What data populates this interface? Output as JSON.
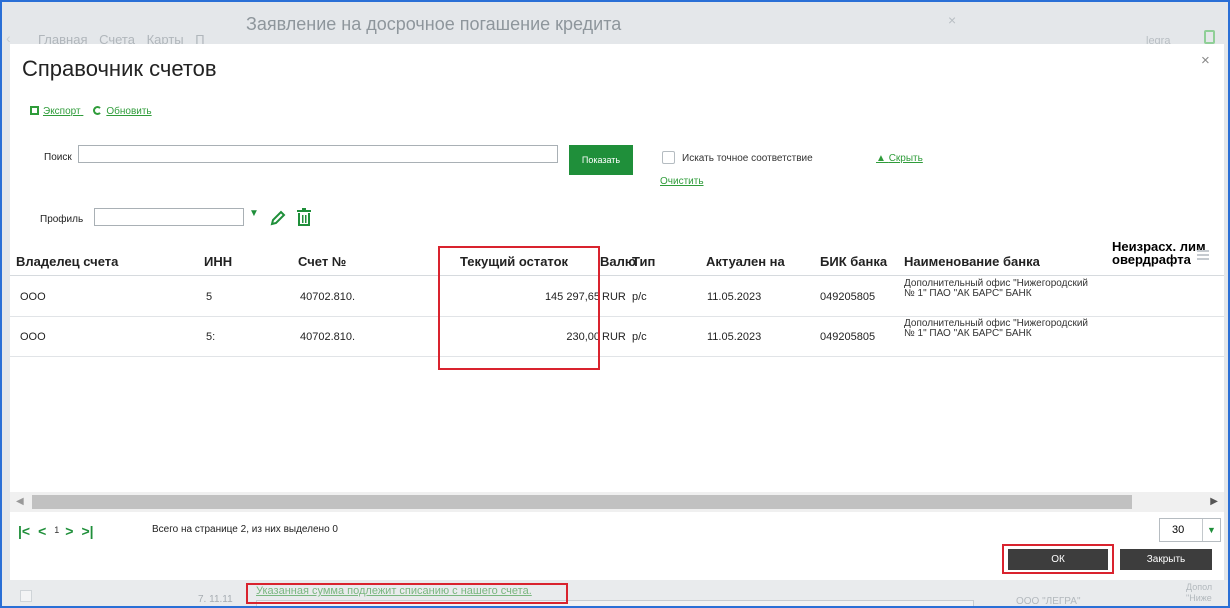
{
  "background": {
    "nav": [
      "Главная",
      "Счета",
      "Карты",
      "П"
    ],
    "title": "Заявление на досрочное погашение кредита",
    "user": "legra",
    "bottom_date": "7. 11.11",
    "bottom_note": "Указанная сумма подлежит списанию с нашего счета.",
    "bottom_org": "ООО \"ЛЕГРА\"",
    "bottom_side": "Допол \"Ниже"
  },
  "modal": {
    "title": "Справочник счетов",
    "export_label": "Экспорт",
    "refresh_label": "Обновить",
    "search_label": "Поиск",
    "search_value": "",
    "show_button": "Показать",
    "exact_match_label": "Искать точное соответствие",
    "hide_label": "Скрыть",
    "clear_label": "Очистить",
    "profile_label": "Профиль",
    "profile_value": ""
  },
  "table": {
    "headers": {
      "owner": "Владелец счета",
      "inn": "ИНН",
      "account": "Счет №",
      "balance": "Текущий остаток",
      "currency": "Валю",
      "type": "Тип",
      "actual": "Актуален на",
      "bik": "БИК банка",
      "bank": "Наименование банка",
      "overdraft_line1": "Неизрасх. лим",
      "overdraft_line2": "овердрафта"
    },
    "rows": [
      {
        "owner": "ООО",
        "inn": "5",
        "account": "40702.810.",
        "balance": "145 297,65",
        "currency": "RUR",
        "type": "р/с",
        "actual": "11.05.2023",
        "bik": "049205805",
        "bank": "Дополнительный офис \"Нижегородский № 1\" ПАО \"АК БАРС\" БАНК"
      },
      {
        "owner": "ООО",
        "inn": "5:",
        "account": "40702.810.",
        "balance": "230,00",
        "currency": "RUR",
        "type": "р/с",
        "actual": "11.05.2023",
        "bik": "049205805",
        "bank": "Дополнительный офис \"Нижегородский № 1\" ПАО \"АК БАРС\" БАНК"
      }
    ]
  },
  "pager": {
    "current_page": "1",
    "info": "Всего на странице 2, из них выделено 0",
    "page_size": "30"
  },
  "buttons": {
    "ok": "ОК",
    "close": "Закрыть"
  },
  "colors": {
    "accent_green": "#1f8f3a",
    "highlight_red": "#d9232e",
    "dark_button": "#3d3d3d"
  }
}
